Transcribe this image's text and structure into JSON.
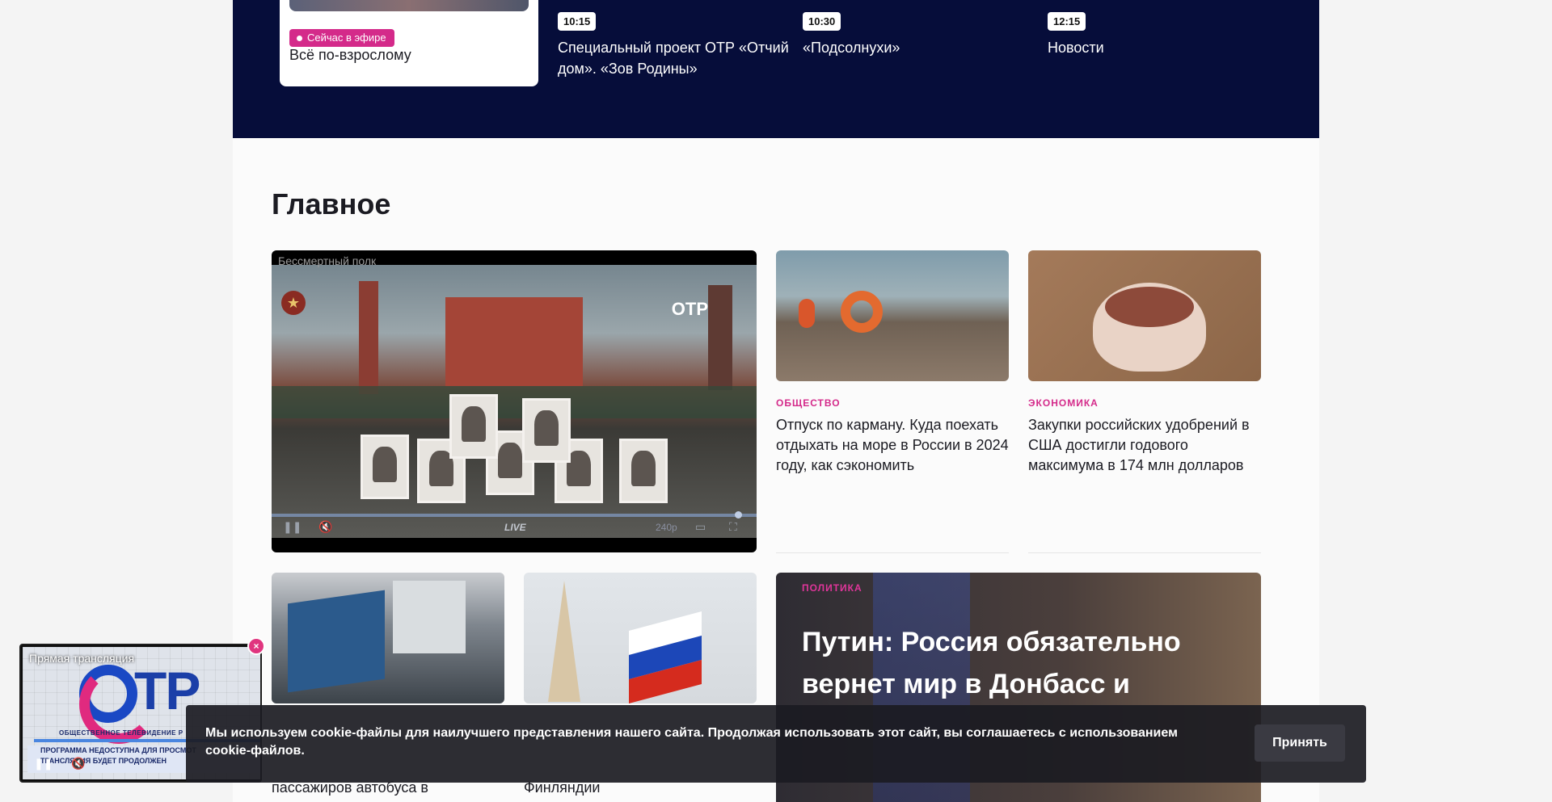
{
  "schedule": {
    "live_label": "Сейчас в эфире",
    "current_title": "Всё по-взрослому",
    "items": [
      {
        "time": "10:15",
        "title": "Специальный проект ОТР «Отчий дом». «Зов Родины»"
      },
      {
        "time": "10:30",
        "title": "«Подсолнухи»"
      },
      {
        "time": "12:15",
        "title": "Новости"
      }
    ]
  },
  "main": {
    "section_title": "Главное",
    "player": {
      "caption": "Бессмертный полк",
      "channel_logo": "ОТР",
      "live_label": "LIVE",
      "quality": "240p"
    },
    "cards": [
      {
        "category": "ОБЩЕСТВО",
        "title": "Отпуск по карману. Куда поехать отдыхать на море в России в 2024 году, как сэкономить"
      },
      {
        "category": "ЭКОНОМИКА",
        "title": "Закупки российских удобрений в США достигли годового максимума в 174 млн долларов"
      }
    ],
    "partial_cards": [
      {
        "title_tail": "пассажиров автобуса в"
      },
      {
        "title_tail": "Финляндии"
      }
    ],
    "featured": {
      "category": "ПОЛИТИКА",
      "title": "Путин: Россия обязательно вернет мир в Донбасс и"
    }
  },
  "mini_player": {
    "caption": "Прямая трансляция",
    "logo_text": "ТР",
    "subtitle": "ОБЩЕСТВЕННОЕ ТЕЛЕВИДЕНИЕ Р",
    "warning_line1": "ПРОГРАММА НЕДОСТУПНА ДЛЯ ПРОСМОТ",
    "warning_line2": "ТРАНСЛЯЦИЯ БУДЕТ ПРОДОЛЖЕН",
    "close_label": "×"
  },
  "cookie": {
    "text": "Мы используем cookie-файлы для наилучшего представления нашего сайта. Продолжая использовать этот сайт, вы соглашаетесь с использованием cookie-файлов.",
    "accept_label": "Принять"
  },
  "colors": {
    "schedule_bg": "#060d3a",
    "accent": "#d42a8a"
  }
}
